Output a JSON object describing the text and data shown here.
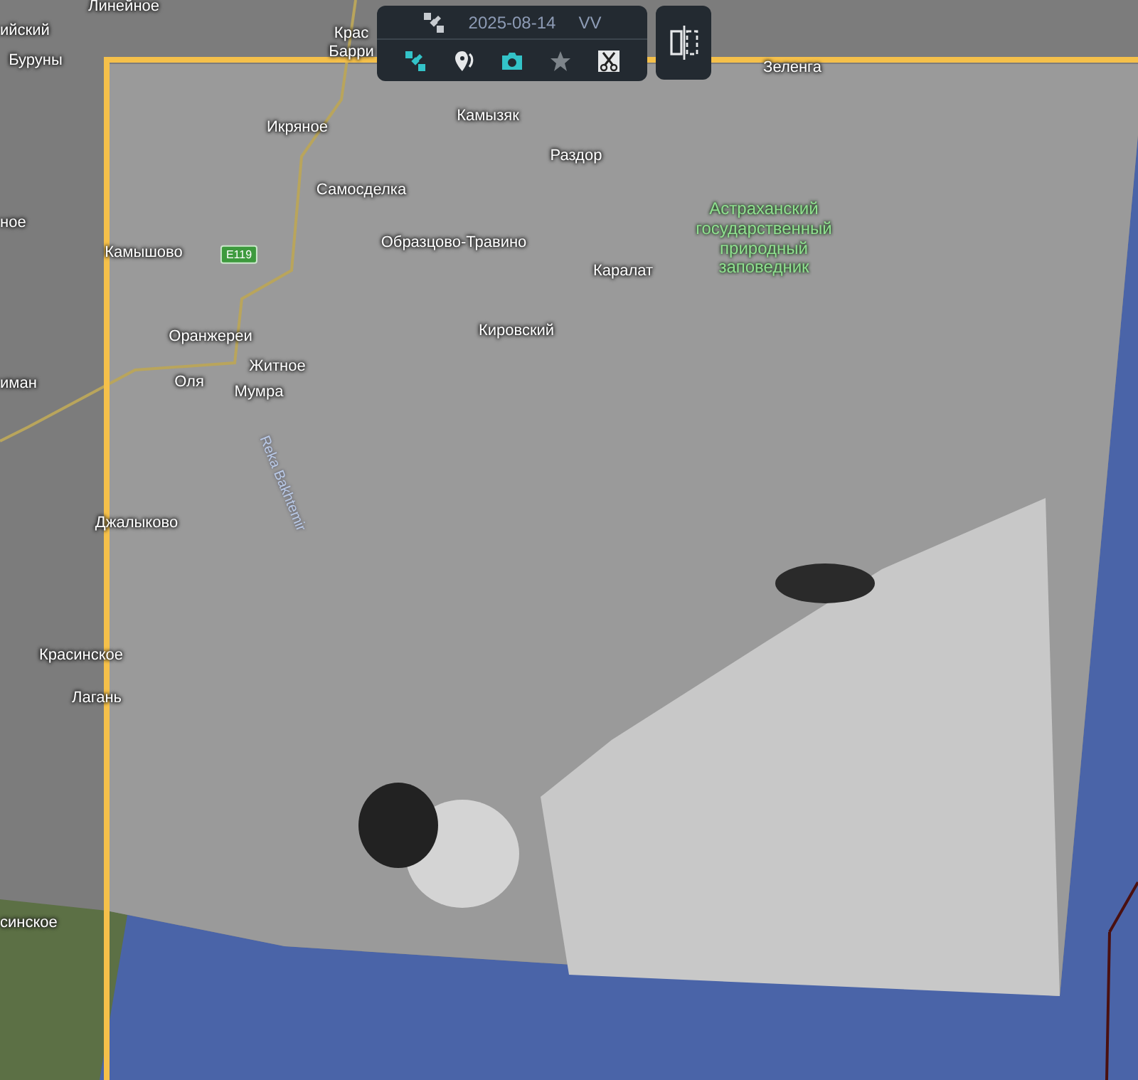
{
  "map": {
    "labels": [
      {
        "text": "Линейное",
        "kind": "place"
      },
      {
        "text": "ийский",
        "kind": "place"
      },
      {
        "text": "Буруны",
        "kind": "place"
      },
      {
        "text": "Крас",
        "kind": "place"
      },
      {
        "text": "Барри",
        "kind": "place"
      },
      {
        "text": "Икряное",
        "kind": "place"
      },
      {
        "text": "Камызяк",
        "kind": "place"
      },
      {
        "text": "Раздор",
        "kind": "place"
      },
      {
        "text": "Самосделка",
        "kind": "place"
      },
      {
        "text": "ное",
        "kind": "place"
      },
      {
        "text": "Образцово-Травино",
        "kind": "place"
      },
      {
        "text": "Камышово",
        "kind": "place"
      },
      {
        "text": "E119",
        "kind": "road"
      },
      {
        "text": "Каралат",
        "kind": "place"
      },
      {
        "text": "Зеленга",
        "kind": "place"
      },
      {
        "text": "Астраханский государственный природный заповедник",
        "kind": "park"
      },
      {
        "text": "Оранжереи",
        "kind": "place"
      },
      {
        "text": "Кировский",
        "kind": "place"
      },
      {
        "text": "Житное",
        "kind": "place"
      },
      {
        "text": "иман",
        "kind": "place"
      },
      {
        "text": "Оля",
        "kind": "place"
      },
      {
        "text": "Мумра",
        "kind": "place"
      },
      {
        "text": "Reka Bakhtemir",
        "kind": "river"
      },
      {
        "text": "Джалыково",
        "kind": "place"
      },
      {
        "text": "Красинское",
        "kind": "place"
      },
      {
        "text": "Лагань",
        "kind": "place"
      },
      {
        "text": "синское",
        "kind": "place"
      }
    ]
  },
  "scene": {
    "date": "2025-08-14",
    "polarization": "VV"
  },
  "tools": [
    {
      "kind": "satellite",
      "active": true,
      "disabled": false
    },
    {
      "kind": "pin",
      "active": false,
      "disabled": false
    },
    {
      "kind": "camera",
      "active": true,
      "disabled": false
    },
    {
      "kind": "star",
      "active": false,
      "disabled": true
    },
    {
      "kind": "cut",
      "active": false,
      "disabled": false
    }
  ]
}
